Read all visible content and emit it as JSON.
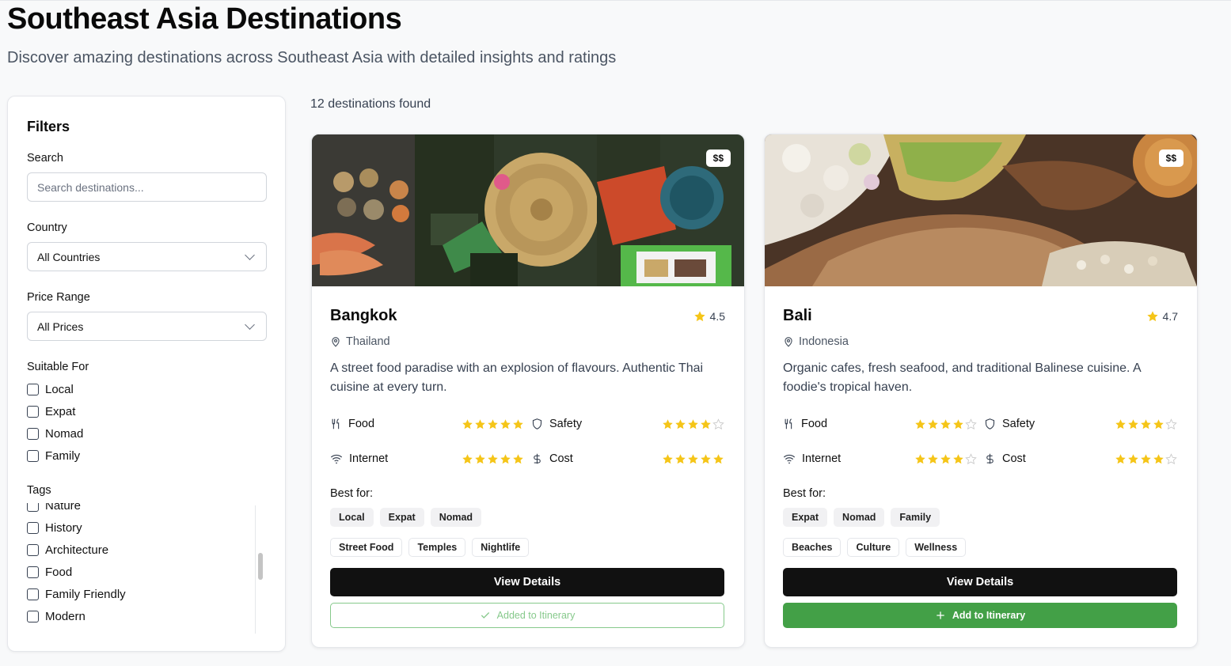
{
  "header": {
    "title": "Southeast Asia Destinations",
    "subtitle": "Discover amazing destinations across Southeast Asia with detailed insights and ratings"
  },
  "filters": {
    "title": "Filters",
    "search_label": "Search",
    "search_placeholder": "Search destinations...",
    "country_label": "Country",
    "country_value": "All Countries",
    "price_label": "Price Range",
    "price_value": "All Prices",
    "suitable_label": "Suitable For",
    "suitable_options": [
      "Local",
      "Expat",
      "Nomad",
      "Family"
    ],
    "tags_label": "Tags",
    "tag_options": [
      "Nature",
      "History",
      "Architecture",
      "Food",
      "Family Friendly",
      "Modern"
    ]
  },
  "results": {
    "count_text": "12 destinations found"
  },
  "colors": {
    "star": "#f5c518",
    "primary": "#111111",
    "add_green": "#43a047",
    "added_green": "#86c98b"
  },
  "cards": [
    {
      "price": "$$",
      "city": "Bangkok",
      "rating": "4.5",
      "country": "Thailand",
      "description": "A street food paradise with an explosion of flavours. Authentic Thai cuisine at every turn.",
      "metrics": {
        "food_label": "Food",
        "food_stars": 5,
        "safety_label": "Safety",
        "safety_stars": 4,
        "internet_label": "Internet",
        "internet_stars": 5,
        "cost_label": "Cost",
        "cost_stars": 5
      },
      "best_for_label": "Best for:",
      "best_for": [
        "Local",
        "Expat",
        "Nomad"
      ],
      "tags": [
        "Street Food",
        "Temples",
        "Nightlife"
      ],
      "details_label": "View Details",
      "itinerary_label": "Added to Itinerary",
      "itinerary_icon": "check-icon"
    },
    {
      "price": "$$",
      "city": "Bali",
      "rating": "4.7",
      "country": "Indonesia",
      "description": "Organic cafes, fresh seafood, and traditional Balinese cuisine. A foodie's tropical haven.",
      "metrics": {
        "food_label": "Food",
        "food_stars": 4,
        "safety_label": "Safety",
        "safety_stars": 4,
        "internet_label": "Internet",
        "internet_stars": 4,
        "cost_label": "Cost",
        "cost_stars": 4
      },
      "best_for_label": "Best for:",
      "best_for": [
        "Expat",
        "Nomad",
        "Family"
      ],
      "tags": [
        "Beaches",
        "Culture",
        "Wellness"
      ],
      "details_label": "View Details",
      "itinerary_label": "Add to Itinerary",
      "itinerary_icon": "plus-icon"
    }
  ]
}
